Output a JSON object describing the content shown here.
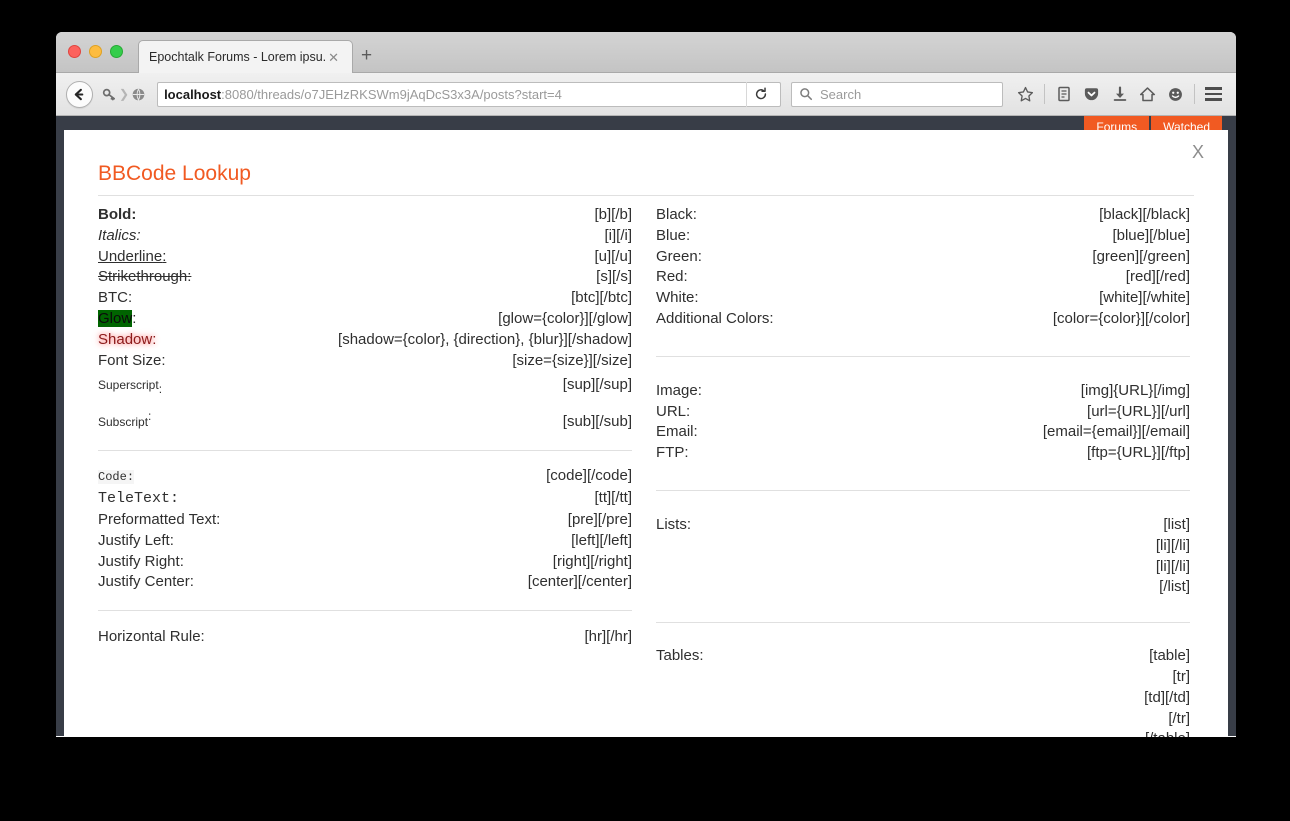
{
  "browser": {
    "tab_title": "Epochtalk Forums - Lorem ipsu...",
    "tab_close_glyph": "✕",
    "new_tab_glyph": "+",
    "url_host": "localhost",
    "url_path": ":8080/threads/o7JEHzRKSWm9jAqDcS3x3A/posts?start=4",
    "search_placeholder": "Search",
    "icons": {
      "back": "back-arrow-icon",
      "identity_key": "key-icon",
      "identity_globe": "globe-icon",
      "reload": "reload-icon",
      "search": "search-icon",
      "bookmark": "star-icon",
      "library": "library-icon",
      "pocket": "pocket-icon",
      "downloads": "download-icon",
      "home": "home-icon",
      "feedback": "smiley-icon",
      "menu": "hamburger-menu-icon"
    }
  },
  "site_nav": {
    "buttons": [
      "Forums",
      "Watched"
    ]
  },
  "modal": {
    "title": "BBCode Lookup",
    "close_label": "X",
    "left_column": [
      {
        "label": "Bold",
        "style": "s-bold",
        "tag": "[b][/b]"
      },
      {
        "label": "Italics",
        "style": "s-italic",
        "tag": "[i][/i]"
      },
      {
        "label": "Underline",
        "style": "s-under",
        "tag": "[u][/u]"
      },
      {
        "label": "Strikethrough",
        "style": "s-strike",
        "tag": "[s][/s]"
      },
      {
        "label": "BTC",
        "style": "",
        "tag": "[btc][/btc]"
      },
      {
        "label": "Glow",
        "style": "s-glow",
        "tag": "[glow={color}][/glow]"
      },
      {
        "label": "Shadow",
        "style": "s-shadow",
        "tag": "[shadow={color}, {direction}, {blur}][/shadow]"
      },
      {
        "label": "Font Size",
        "style": "",
        "tag": "[size={size}][/size]"
      },
      {
        "label": "Superscript",
        "style": "s-small",
        "tag": "[sup][/sup]",
        "mark": "sup"
      },
      {
        "label": "Subscript",
        "style": "s-small",
        "tag": "[sub][/sub]",
        "mark": "sub"
      }
    ],
    "left_column_2": [
      {
        "label": "Code",
        "style": "s-code",
        "tag": "[code][/code]"
      },
      {
        "label": "TeleText",
        "style": "s-mono",
        "tag": "[tt][/tt]"
      },
      {
        "label": "Preformatted Text",
        "style": "",
        "tag": "[pre][/pre]"
      },
      {
        "label": "Justify Left",
        "style": "",
        "tag": "[left][/left]"
      },
      {
        "label": "Justify Right",
        "style": "",
        "tag": "[right][/right]"
      },
      {
        "label": "Justify Center",
        "style": "",
        "tag": "[center][/center]"
      }
    ],
    "left_column_3": [
      {
        "label": "Horizontal Rule",
        "style": "",
        "tag": "[hr][/hr]"
      }
    ],
    "right_column": [
      {
        "label": "Black",
        "tag": "[black][/black]"
      },
      {
        "label": "Blue",
        "tag": "[blue][/blue]"
      },
      {
        "label": "Green",
        "tag": "[green][/green]"
      },
      {
        "label": "Red",
        "tag": "[red][/red]"
      },
      {
        "label": "White",
        "tag": "[white][/white]"
      },
      {
        "label": "Additional Colors",
        "tag": "[color={color}][/color]"
      }
    ],
    "right_column_2": [
      {
        "label": "Image",
        "tag": "[img]{URL}[/img]"
      },
      {
        "label": "URL",
        "tag": "[url={URL}][/url]"
      },
      {
        "label": "Email",
        "tag": "[email={email}][/email]"
      },
      {
        "label": "FTP",
        "tag": "[ftp={URL}][/ftp]"
      }
    ],
    "right_column_3": {
      "label": "Lists",
      "lines": [
        "[list]",
        "[li][/li]",
        "[li][/li]",
        "[/list]"
      ]
    },
    "right_column_4": {
      "label": "Tables",
      "lines": [
        "[table]",
        "[tr]",
        "[td][/td]",
        "[/tr]",
        "[/table]"
      ]
    }
  },
  "colors": {
    "accent": "#f15a22",
    "page_bg": "#383d47",
    "glow_bg": "#006400",
    "shadow_fg": "#8b1a1a"
  }
}
